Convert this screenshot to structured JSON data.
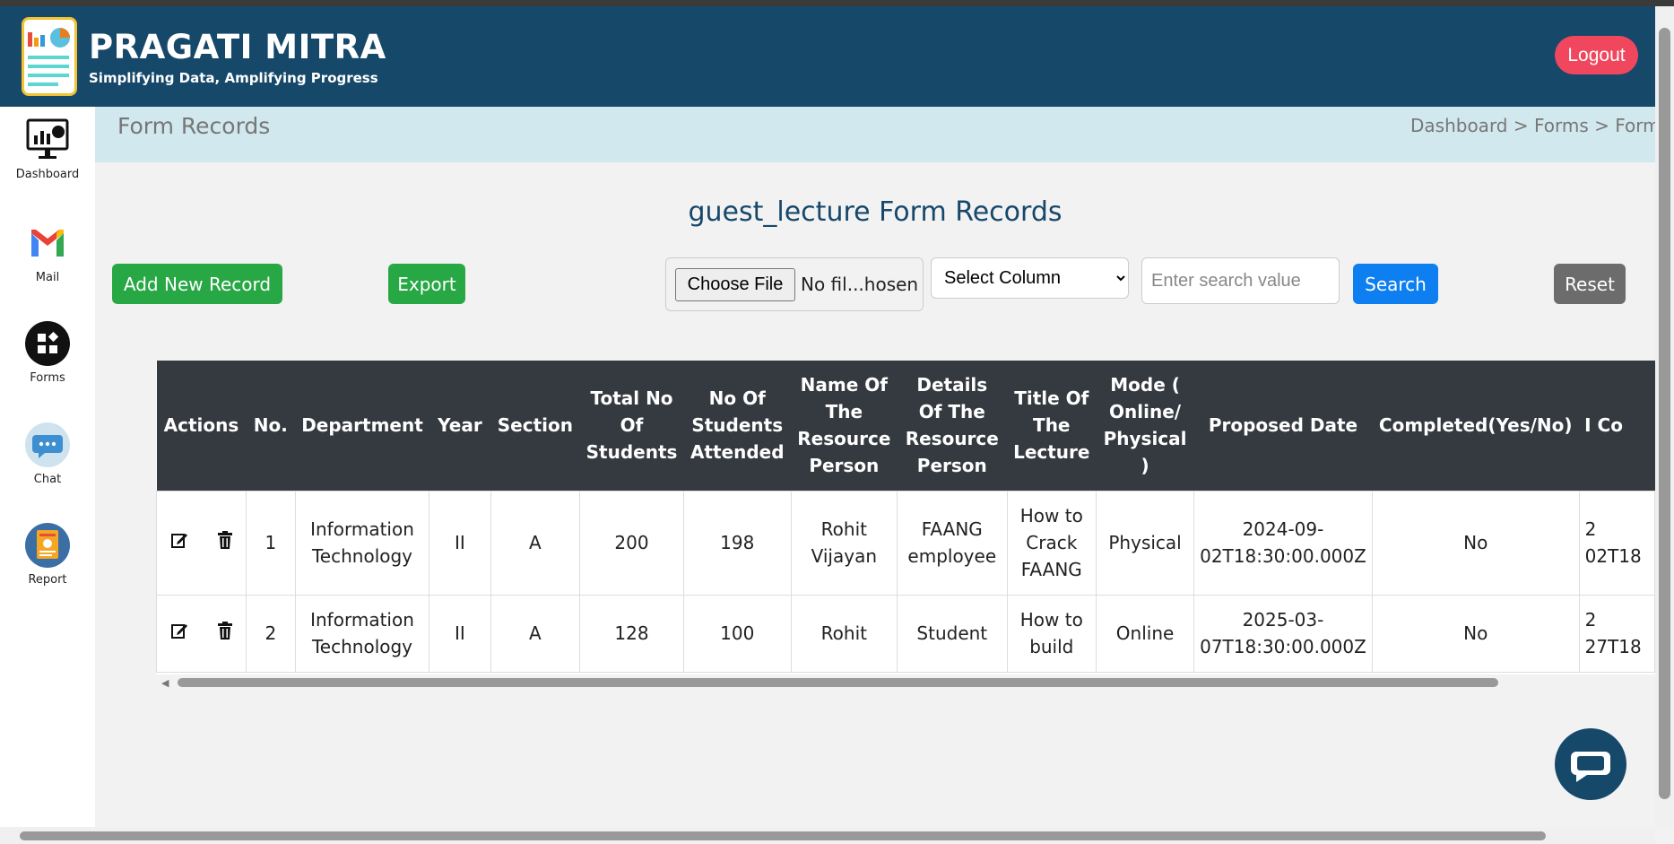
{
  "app": {
    "brand_title": "PRAGATI MITRA",
    "brand_subtitle": "Simplifying Data, Amplifying Progress",
    "logout_label": "Logout"
  },
  "sidebar": {
    "items": [
      {
        "label": "Dashboard",
        "icon": "dashboard-icon"
      },
      {
        "label": "Mail",
        "icon": "mail-icon"
      },
      {
        "label": "Forms",
        "icon": "forms-icon"
      },
      {
        "label": "Chat",
        "icon": "chat-icon"
      },
      {
        "label": "Report",
        "icon": "report-icon"
      }
    ]
  },
  "page": {
    "title": "Form Records",
    "breadcrumb": "Dashboard > Forms > Form",
    "heading": "guest_lecture Form Records"
  },
  "toolbar": {
    "add_label": "Add New Record",
    "export_label": "Export",
    "choose_file_label": "Choose File",
    "file_name": "No fil...hosen",
    "select_column": "Select Column",
    "search_placeholder": "Enter search value",
    "search_label": "Search",
    "reset_label": "Reset"
  },
  "table": {
    "headers": [
      "Actions",
      "No.",
      "Department",
      "Year",
      "Section",
      "Total No Of Students",
      "No Of Students Attended",
      "Name Of The Resource Person",
      "Details Of The Resource Person",
      "Title Of The Lecture",
      "Mode ( Online/ Physical )",
      "Proposed Date",
      "Completed(Yes/No)",
      "I Co"
    ],
    "rows": [
      {
        "no": "1",
        "department": "Information Technology",
        "year": "II",
        "section": "A",
        "total": "200",
        "attended": "198",
        "resource_name": "Rohit Vijayan",
        "resource_details": "FAANG employee",
        "title": "How to Crack FAANG",
        "mode": "Physical",
        "proposed_date": "2024-09-02T18:30:00.000Z",
        "completed": "No",
        "partial": "2 02T18"
      },
      {
        "no": "2",
        "department": "Information Technology",
        "year": "II",
        "section": "A",
        "total": "128",
        "attended": "100",
        "resource_name": "Rohit",
        "resource_details": "Student",
        "title": "How to build",
        "mode": "Online",
        "proposed_date": "2025-03-07T18:30:00.000Z",
        "completed": "No",
        "partial": "2 27T18"
      }
    ]
  },
  "colors": {
    "header_bg": "#16486a",
    "logout_bg": "#f0475e",
    "green": "#28a745",
    "blue": "#0d7ff0",
    "table_head": "#343a40"
  }
}
